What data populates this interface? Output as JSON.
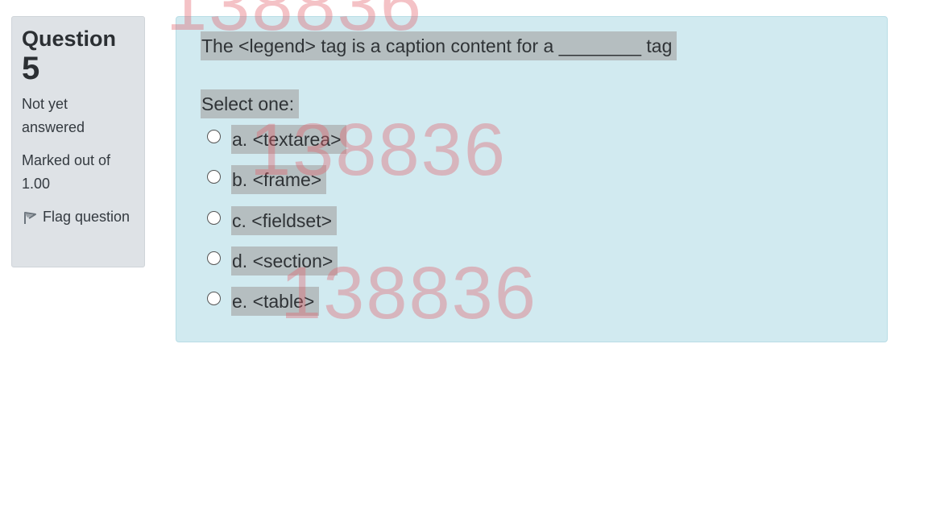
{
  "info": {
    "question_label": "Question",
    "question_number": "5",
    "status": "Not yet answered",
    "marks": "Marked out of 1.00",
    "flag_label": "Flag question"
  },
  "question": {
    "text": "The <legend> tag is a caption content for a ________ tag",
    "prompt": "Select one:",
    "answers": [
      {
        "label": "a. <textarea>"
      },
      {
        "label": "b. <frame>"
      },
      {
        "label": "c. <fieldset>"
      },
      {
        "label": "d. <section>"
      },
      {
        "label": "e. <table>"
      }
    ]
  },
  "watermark": {
    "text": "138836"
  },
  "colors": {
    "content_bg": "#d1eaf0",
    "info_bg": "#dee2e6",
    "highlight": "#b5bec0",
    "watermark": "#e15f69"
  }
}
